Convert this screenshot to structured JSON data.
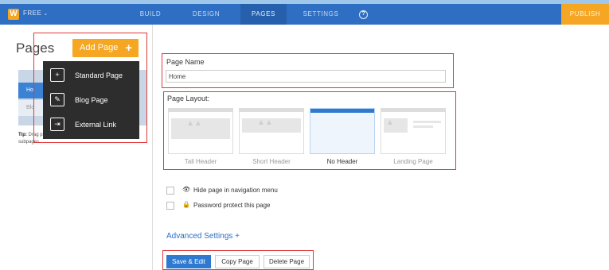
{
  "topbar": {
    "logo": "W",
    "plan": "FREE",
    "tabs": [
      "BUILD",
      "DESIGN",
      "PAGES",
      "SETTINGS"
    ],
    "active_tab": "PAGES",
    "help": "?",
    "publish": "PUBLISH"
  },
  "sidebar": {
    "title": "Pages",
    "add_page": "Add Page",
    "add_icon": "+",
    "rows": [
      "Ho",
      "Blo"
    ],
    "tip_bold": "Tip:",
    "tip_text": " Drag pages up/down to reorder, left/right to create subpages.",
    "dropdown": [
      {
        "label": "Standard Page",
        "icon": "standard-page-icon",
        "glyph": "+"
      },
      {
        "label": "Blog Page",
        "icon": "blog-page-icon",
        "glyph": "✎"
      },
      {
        "label": "External Link",
        "icon": "external-link-icon",
        "glyph": "⇥"
      }
    ]
  },
  "main": {
    "page_name_label": "Page Name",
    "page_name_value": "Home",
    "page_layout_label": "Page Layout:",
    "layouts": [
      "Tall Header",
      "Short Header",
      "No Header",
      "Landing Page"
    ],
    "selected_layout": "No Header",
    "options": [
      {
        "label": "Hide page in navigation menu",
        "icon": "eye-hidden-icon",
        "glyph": "👁"
      },
      {
        "label": "Password protect this page",
        "icon": "lock-icon",
        "glyph": "🔒"
      }
    ],
    "advanced": "Advanced Settings",
    "advanced_plus": "+",
    "buttons": {
      "save": "Save & Edit",
      "copy": "Copy Page",
      "delete": "Delete Page"
    }
  },
  "colors": {
    "nav": "#2e6fc4",
    "accent": "#f5a623",
    "highlight": "#e03a3a"
  }
}
